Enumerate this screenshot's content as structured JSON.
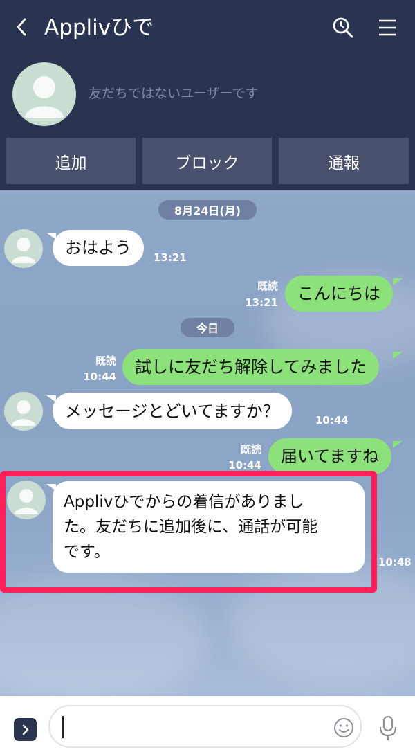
{
  "header": {
    "title": "Applivひで",
    "not_friend_notice": "友だちではないユーザーです",
    "buttons": {
      "add": "追加",
      "block": "ブロック",
      "report": "通報"
    }
  },
  "chat": {
    "date_labels": [
      "8月24日(月)",
      "今日"
    ],
    "messages": [
      {
        "direction": "in",
        "text": "おはよう",
        "time": "13:21"
      },
      {
        "direction": "out",
        "text": "こんにちは",
        "read": "既読",
        "time": "13:21"
      },
      {
        "direction": "out",
        "text": "試しに友だち解除してみました",
        "read": "既読",
        "time": "10:44"
      },
      {
        "direction": "in",
        "text": "メッセージとどいてますか？",
        "time": "10:44"
      },
      {
        "direction": "out",
        "text": "届いてますね",
        "read": "既読",
        "time": "10:44"
      },
      {
        "direction": "in",
        "lines": [
          "Applivひでからの着信がありまし",
          "た。友だちに追加後に、通話が可能",
          "です。"
        ],
        "time": "10:48"
      }
    ]
  },
  "input": {
    "value": "",
    "placeholder": ""
  },
  "icons": {
    "back": "chevron-left-icon",
    "search": "search-icon",
    "menu": "menu-icon",
    "expand": "chevron-right-icon",
    "emoji": "emoji-icon",
    "mic": "microphone-icon"
  },
  "colors": {
    "header_bg": "#2a3350",
    "outgoing_bubble": "#8de17a",
    "incoming_bubble": "#ffffff",
    "highlight_border": "#ff1f5a"
  }
}
